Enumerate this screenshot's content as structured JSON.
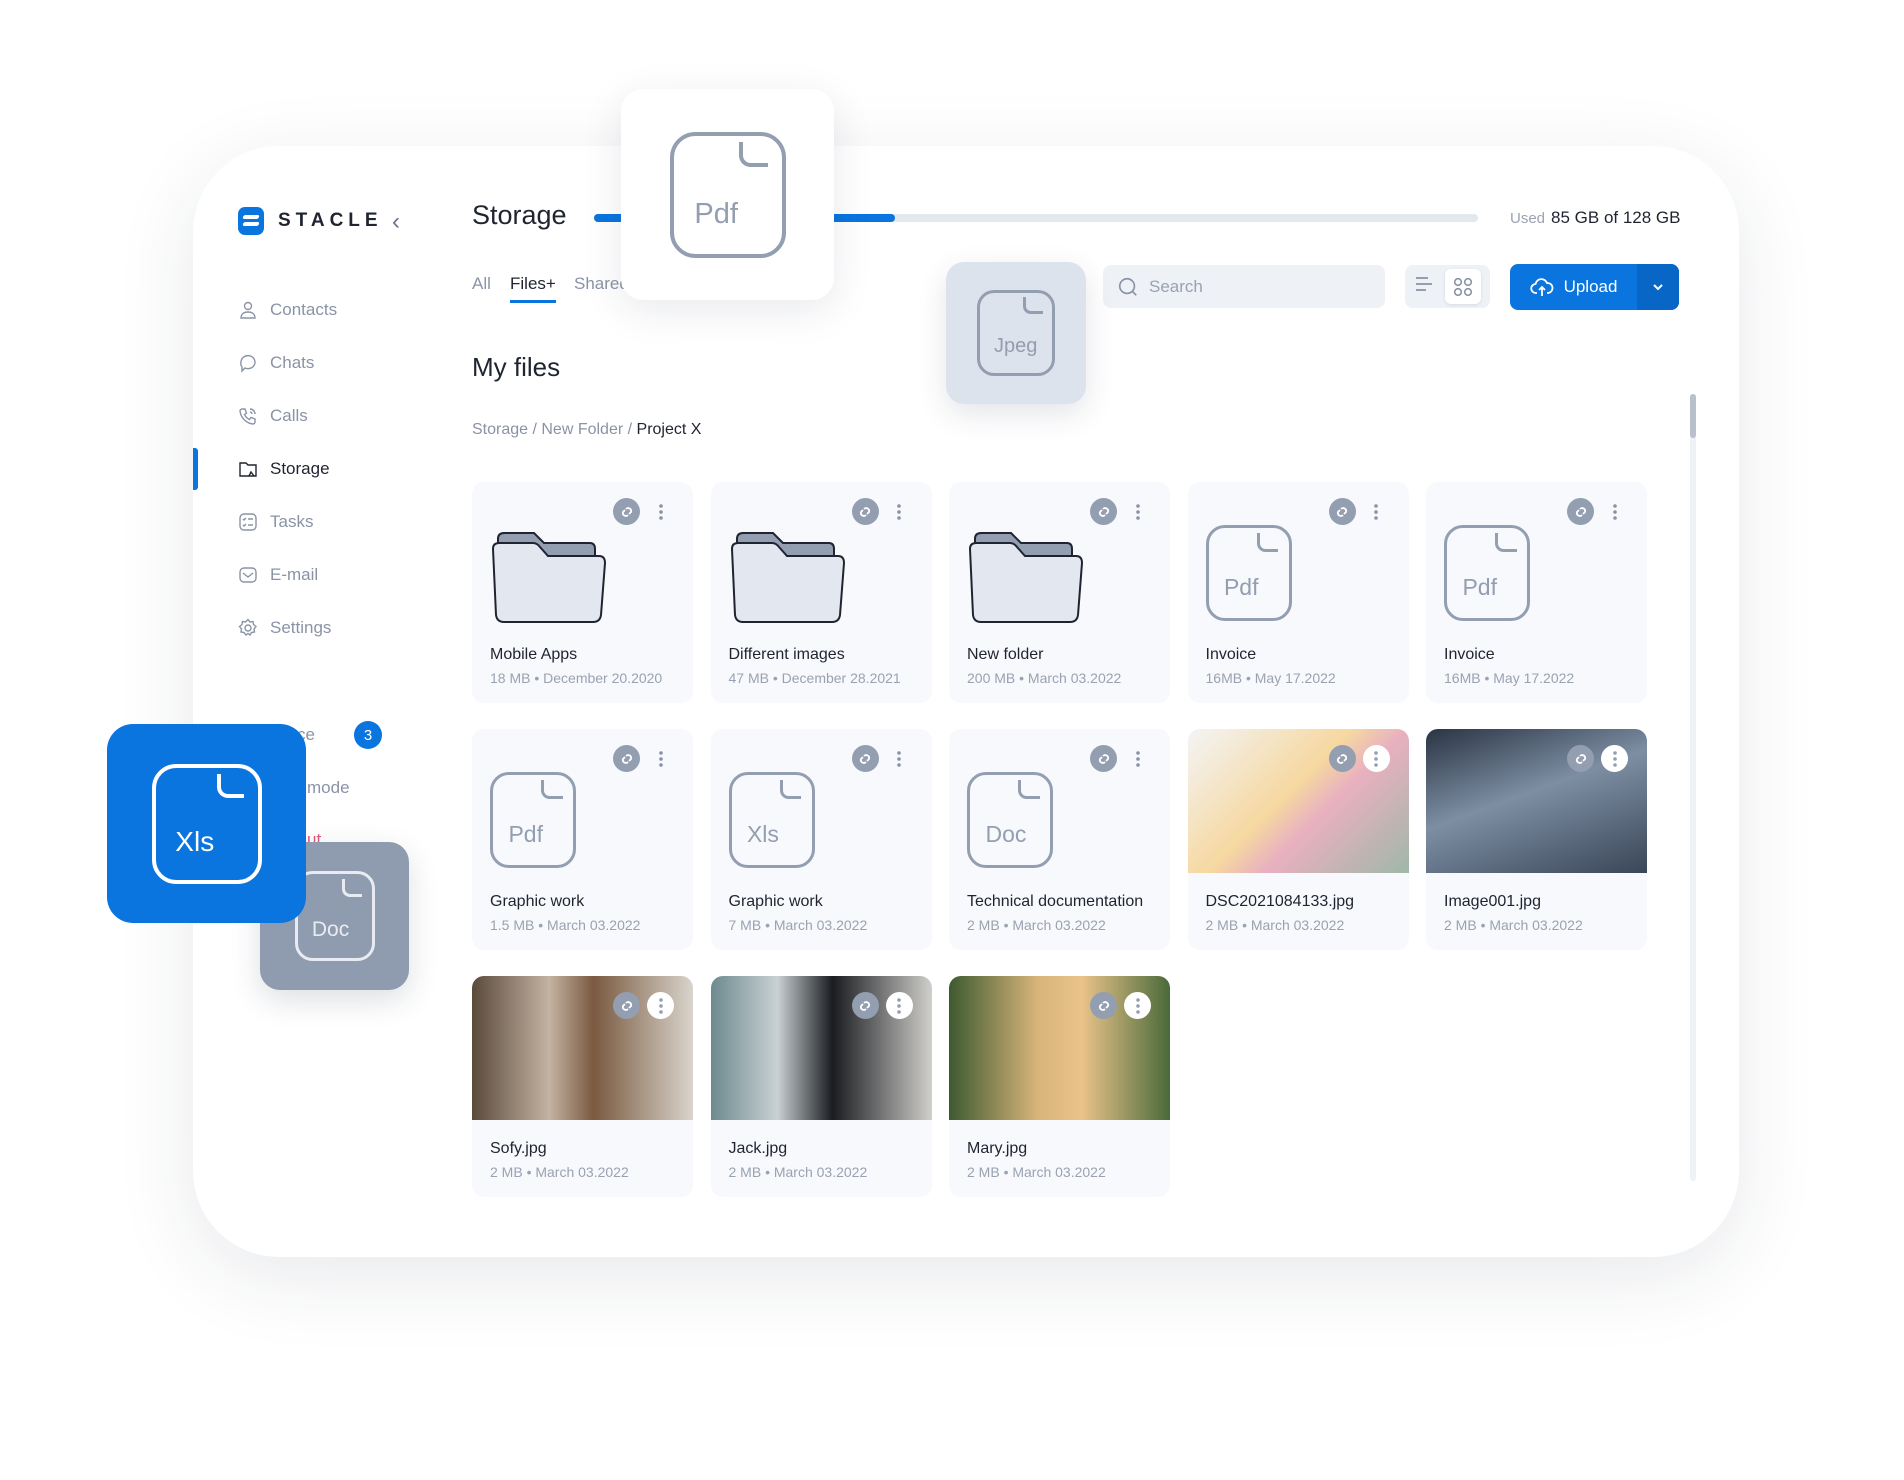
{
  "brand": {
    "name": "STACLE",
    "accent": "#0a74df"
  },
  "sidebar": {
    "items": [
      {
        "label": "Contacts",
        "icon": "user-icon"
      },
      {
        "label": "Chats",
        "icon": "chat-icon"
      },
      {
        "label": "Calls",
        "icon": "phone-icon"
      },
      {
        "label": "Storage",
        "icon": "folder-icon",
        "active": true
      },
      {
        "label": "Tasks",
        "icon": "tasks-icon"
      },
      {
        "label": "E-mail",
        "icon": "mail-icon"
      },
      {
        "label": "Settings",
        "icon": "gear-icon"
      }
    ],
    "partial_items": [
      {
        "label": "ce",
        "badge": "3"
      },
      {
        "label": "mode"
      },
      {
        "label": "ut"
      }
    ]
  },
  "header": {
    "title": "Storage",
    "used_label": "Used",
    "used_value": "85 GB of 128 GB",
    "progress_fill_fraction": 0.34
  },
  "tabs": [
    {
      "label": "All"
    },
    {
      "label": "Files+",
      "active": true
    },
    {
      "label": "Shared"
    }
  ],
  "toolbar": {
    "search_placeholder": "Search",
    "upload_label": "Upload",
    "view": "grid"
  },
  "section_title": "My files",
  "breadcrumb": {
    "parts": [
      "Storage / New Folder / "
    ],
    "current": "Project X"
  },
  "floating_icons": {
    "pdf": "Pdf",
    "jpeg": "Jpeg",
    "xls": "Xls",
    "doc": "Doc"
  },
  "files": [
    {
      "name": "Mobile Apps",
      "meta": "18 MB • December 20.2020",
      "type": "folder"
    },
    {
      "name": "Different images",
      "meta": "47 MB • December 28.2021",
      "type": "folder"
    },
    {
      "name": "New folder",
      "meta": "200 MB • March 03.2022",
      "type": "folder"
    },
    {
      "name": "Invoice",
      "meta": "16MB • May 17.2022",
      "type": "doc",
      "label": "Pdf"
    },
    {
      "name": "Invoice",
      "meta": "16MB • May 17.2022",
      "type": "doc",
      "label": "Pdf"
    },
    {
      "name": "Graphic work",
      "meta": "1.5 MB • March 03.2022",
      "type": "doc",
      "label": "Pdf"
    },
    {
      "name": "Graphic work",
      "meta": "7 MB • March 03.2022",
      "type": "doc",
      "label": "Xls"
    },
    {
      "name": "Technical documentation",
      "meta": "2 MB • March 03.2022",
      "type": "doc",
      "label": "Doc"
    },
    {
      "name": "DSC2021084133.jpg",
      "meta": "2 MB • March 03.2022",
      "type": "image",
      "bg": "linear-gradient(135deg,#f3f4f6,#f6d8a0 45%,#e8b0c0 60%,#9fb8a8)"
    },
    {
      "name": "Image001.jpg",
      "meta": "2 MB • March 03.2022",
      "type": "image",
      "bg": "linear-gradient(160deg,#2a3444,#7d8ea3 45%,#3a4658)"
    },
    {
      "name": "Sofy.jpg",
      "meta": "2 MB • March 03.2022",
      "type": "image",
      "bg": "linear-gradient(90deg,#5a4a3c,#c4b3a2 35%,#7a5a40 55%,#d9d4cc)"
    },
    {
      "name": "Jack.jpg",
      "meta": "2 MB • March 03.2022",
      "type": "image",
      "bg": "linear-gradient(90deg,#6d8a8f,#c9d1d3 30%,#1a1c20 55%,#d0cfcb)"
    },
    {
      "name": "Mary.jpg",
      "meta": "2 MB • March 03.2022",
      "type": "image",
      "bg": "linear-gradient(90deg,#3d5a30,#d8b47a 40%,#e9c38a 60%,#4a6a3a)"
    }
  ]
}
